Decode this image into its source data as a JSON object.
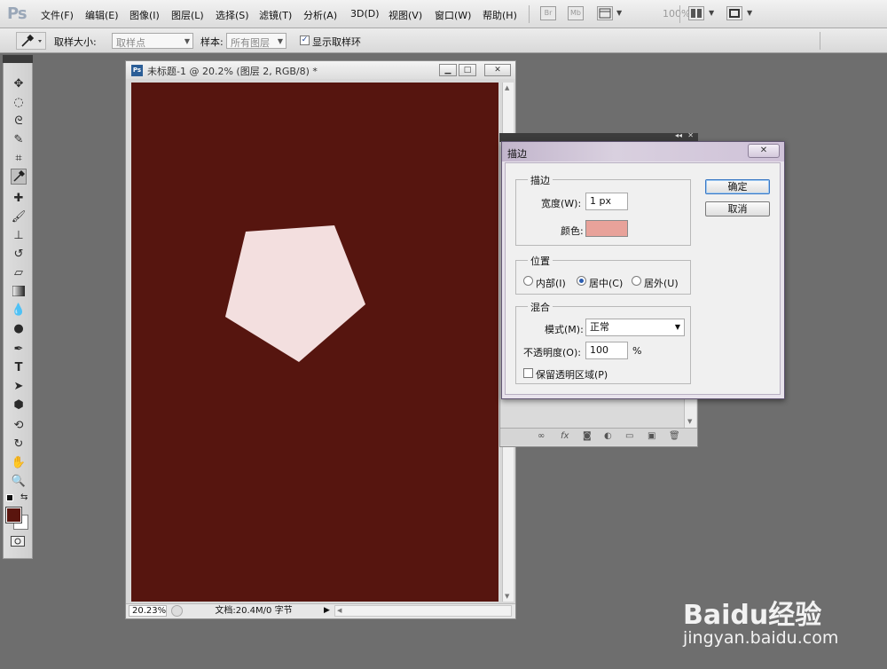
{
  "app": {
    "logo": "Ps"
  },
  "menubar": {
    "items": [
      "文件(F)",
      "编辑(E)",
      "图像(I)",
      "图层(L)",
      "选择(S)",
      "滤镜(T)",
      "分析(A)",
      "3D(D)",
      "视图(V)",
      "窗口(W)",
      "帮助(H)"
    ],
    "badges": [
      "Br",
      "Mb"
    ],
    "zoom": "100%",
    "icons": [
      "bridge-icon",
      "mini-bridge-icon",
      "view-extras-icon",
      "arrange-documents-icon",
      "screen-mode-icon"
    ]
  },
  "options_bar": {
    "tool_icon": "eyedropper-icon",
    "sample_size_label": "取样大小:",
    "sample_size_value": "取样点",
    "sample_label": "样本:",
    "sample_value": "所有图层",
    "show_ring_label": "显示取样环",
    "show_ring_checked": true
  },
  "tools": [
    "move-icon",
    "marquee-icon",
    "lasso-icon",
    "quick-select-icon",
    "crop-icon",
    "eyedropper-icon",
    "healing-brush-icon",
    "brush-icon",
    "clone-stamp-icon",
    "history-brush-icon",
    "eraser-icon",
    "gradient-icon",
    "blur-icon",
    "dodge-icon",
    "pen-icon",
    "type-icon",
    "path-select-icon",
    "shape-icon",
    "3d-rotate-icon",
    "3d-orbit-icon",
    "hand-icon",
    "zoom-icon"
  ],
  "colors": {
    "foreground": "#5a150e",
    "background": "#ffffff",
    "canvas": "#56150f",
    "shape_fill": "#f3dfdf",
    "stroke_swatch": "#e8a29a",
    "accent": "#2a5cb0"
  },
  "document": {
    "title": "未标题-1 @ 20.2% (图层 2, RGB/8) *",
    "zoom": "20.23%",
    "status": "文档:20.4M/0 字节"
  },
  "dialog": {
    "title": "描边",
    "stroke_group": "描边",
    "width_label": "宽度(W):",
    "width_value": "1 px",
    "color_label": "颜色:",
    "position_group": "位置",
    "position_options": [
      "内部(I)",
      "居中(C)",
      "居外(U)"
    ],
    "position_selected": "居中(C)",
    "blend_group": "混合",
    "mode_label": "模式(M):",
    "mode_value": "正常",
    "opacity_label": "不透明度(O):",
    "opacity_value": "100",
    "opacity_unit": "%",
    "preserve_label": "保留透明区域(P)",
    "preserve_checked": false,
    "ok_button": "确定",
    "cancel_button": "取消"
  },
  "watermark": {
    "logo": "Baidu经验",
    "url": "jingyan.baidu.com"
  }
}
